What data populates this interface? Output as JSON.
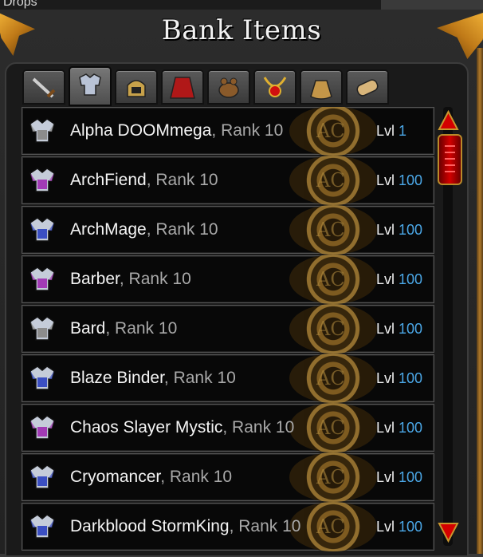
{
  "window": {
    "top_title": "Drops",
    "close_glyph": "✕",
    "title": "Bank Items"
  },
  "tabs": [
    {
      "icon": "sword-icon",
      "active": false
    },
    {
      "icon": "armor-icon",
      "active": true
    },
    {
      "icon": "helm-icon",
      "active": false
    },
    {
      "icon": "cape-icon",
      "active": false
    },
    {
      "icon": "pet-icon",
      "active": false
    },
    {
      "icon": "necklace-icon",
      "active": false
    },
    {
      "icon": "bag-icon",
      "active": false
    },
    {
      "icon": "scroll-icon",
      "active": false
    }
  ],
  "items": [
    {
      "name": "Alpha DOOMmega",
      "rank": ", Rank 10",
      "lvl_label": "Lvl",
      "lvl": "1",
      "icon_tint": "#8c8c8c"
    },
    {
      "name": "ArchFiend",
      "rank": ", Rank 10",
      "lvl_label": "Lvl",
      "lvl": "100",
      "icon_tint": "#a23bb5"
    },
    {
      "name": "ArchMage",
      "rank": ", Rank 10",
      "lvl_label": "Lvl",
      "lvl": "100",
      "icon_tint": "#3b4fc2"
    },
    {
      "name": "Barber",
      "rank": ", Rank 10",
      "lvl_label": "Lvl",
      "lvl": "100",
      "icon_tint": "#a23bb5"
    },
    {
      "name": "Bard",
      "rank": ", Rank 10",
      "lvl_label": "Lvl",
      "lvl": "100",
      "icon_tint": "#8c8c8c"
    },
    {
      "name": "Blaze Binder",
      "rank": ", Rank 10",
      "lvl_label": "Lvl",
      "lvl": "100",
      "icon_tint": "#3b4fc2"
    },
    {
      "name": "Chaos Slayer Mystic",
      "rank": ", Rank 10",
      "lvl_label": "Lvl",
      "lvl": "100",
      "icon_tint": "#a23bb5"
    },
    {
      "name": "Cryomancer",
      "rank": ", Rank 10",
      "lvl_label": "Lvl",
      "lvl": "100",
      "icon_tint": "#3b4fc2"
    },
    {
      "name": "Darkblood StormKing",
      "rank": ", Rank 10",
      "lvl_label": "Lvl",
      "lvl": "100",
      "icon_tint": "#3b4fc2"
    }
  ],
  "emblem_text": "AC",
  "colors": {
    "level_number": "#4ba8e8",
    "scrollbar": "#d20000"
  }
}
